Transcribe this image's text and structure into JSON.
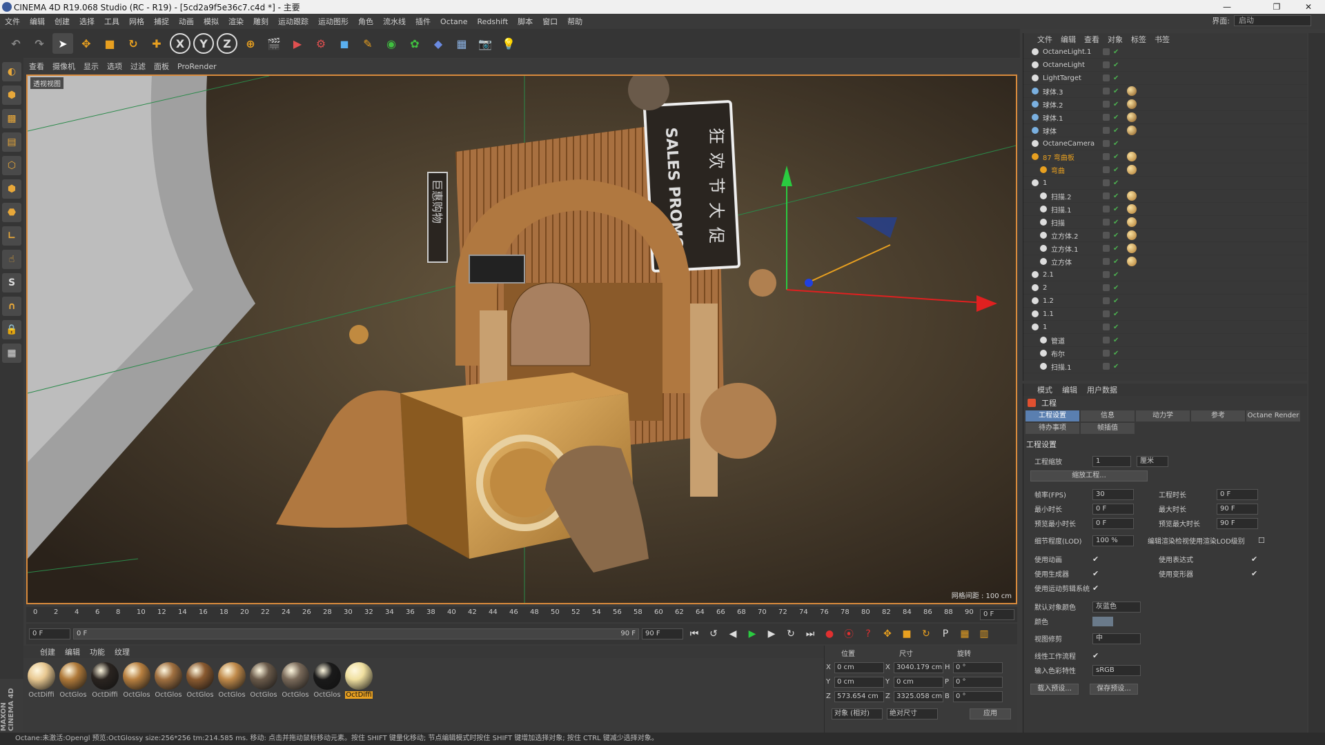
{
  "title": "CINEMA 4D R19.068 Studio (RC - R19) - [5cd2a9f5e36c7.c4d *] - 主要",
  "window_controls": {
    "min": "—",
    "max": "❐",
    "close": "✕"
  },
  "menu": [
    "文件",
    "编辑",
    "创建",
    "选择",
    "工具",
    "网格",
    "捕捉",
    "动画",
    "模拟",
    "渲染",
    "雕刻",
    "运动跟踪",
    "运动图形",
    "角色",
    "流水线",
    "插件",
    "Octane",
    "Redshift",
    "脚本",
    "窗口",
    "帮助"
  ],
  "layout": {
    "label": "界面:",
    "value": "启动"
  },
  "viewport_menu": [
    "查看",
    "摄像机",
    "显示",
    "选项",
    "过滤",
    "面板",
    "ProRender"
  ],
  "viewport": {
    "label": "透视视图",
    "grid_label": "网格间距 : 100 cm",
    "sign_text": "SALES PROMOTION",
    "sign_cn": "狂欢节大促",
    "sign_left": "巨惠购物"
  },
  "timeline": {
    "ticks": [
      "0",
      "2",
      "4",
      "6",
      "8",
      "10",
      "12",
      "14",
      "16",
      "18",
      "20",
      "22",
      "24",
      "26",
      "28",
      "30",
      "32",
      "34",
      "36",
      "38",
      "40",
      "42",
      "44",
      "46",
      "48",
      "50",
      "52",
      "54",
      "56",
      "58",
      "60",
      "62",
      "64",
      "66",
      "68",
      "70",
      "72",
      "74",
      "76",
      "78",
      "80",
      "82",
      "84",
      "86",
      "88",
      "90"
    ],
    "current": "0 F"
  },
  "playback": {
    "start": "0 F",
    "range_start": "0 F",
    "range_end": "90 F",
    "end": "90 F"
  },
  "material_menu": [
    "创建",
    "编辑",
    "功能",
    "纹理"
  ],
  "materials": [
    {
      "name": "OctDiffi",
      "color": "#e8c891"
    },
    {
      "name": "OctGlos",
      "color": "#b07a3a"
    },
    {
      "name": "OctDiffi",
      "color": "#2a2420"
    },
    {
      "name": "OctGlos",
      "color": "#b88040"
    },
    {
      "name": "OctGlos",
      "color": "#a07040"
    },
    {
      "name": "OctGlos",
      "color": "#8a5a30"
    },
    {
      "name": "OctGlos",
      "color": "#c08a4a"
    },
    {
      "name": "OctGlos",
      "color": "#6a5a4a"
    },
    {
      "name": "OctGlos",
      "color": "#7a6a5a"
    },
    {
      "name": "OctGlos",
      "color": "#1a1a1a"
    },
    {
      "name": "OctDiffi",
      "color": "#f0e0a0"
    }
  ],
  "coords": {
    "headers": [
      "位置",
      "尺寸",
      "旋转"
    ],
    "rows": [
      {
        "a": "X",
        "pos": "0 cm",
        "b": "X",
        "size": "3040.179 cm",
        "c": "H",
        "rot": "0 °"
      },
      {
        "a": "Y",
        "pos": "0 cm",
        "b": "Y",
        "size": "0 cm",
        "c": "P",
        "rot": "0 °"
      },
      {
        "a": "Z",
        "pos": "573.654 cm",
        "b": "Z",
        "size": "3325.058 cm",
        "c": "B",
        "rot": "0 °"
      }
    ],
    "mode1": "对象 (相对)",
    "mode2": "绝对尺寸",
    "apply": "应用"
  },
  "status": "Octane:未激活:Opengl 预览:OctGlossy size:256*256 tm:214.585 ms.   移动: 点击并拖动鼠标移动元素。按住 SHIFT 键量化移动; 节点编辑模式时按住 SHIFT 键增加选择对象; 按住 CTRL 键减少选择对象。",
  "logo": "MAXON CINEMA 4D",
  "objects_menu": [
    "文件",
    "编辑",
    "查看",
    "对象",
    "标签",
    "书签"
  ],
  "objects": [
    {
      "name": "OctaneLight.1",
      "indent": 0,
      "color": "#ddd",
      "hl": false
    },
    {
      "name": "OctaneLight",
      "indent": 0,
      "color": "#ddd",
      "hl": false
    },
    {
      "name": "LightTarget",
      "indent": 0,
      "color": "#ddd",
      "hl": false
    },
    {
      "name": "球体.3",
      "indent": 0,
      "color": "#7ab0e0",
      "hl": false
    },
    {
      "name": "球体.2",
      "indent": 0,
      "color": "#7ab0e0",
      "hl": false
    },
    {
      "name": "球体.1",
      "indent": 0,
      "color": "#7ab0e0",
      "hl": false
    },
    {
      "name": "球体",
      "indent": 0,
      "color": "#7ab0e0",
      "hl": false
    },
    {
      "name": "OctaneCamera",
      "indent": 0,
      "color": "#ddd",
      "hl": false
    },
    {
      "name": "87 弯曲板",
      "indent": 0,
      "color": "#e8a020",
      "hl": true
    },
    {
      "name": "弯曲",
      "indent": 1,
      "color": "#e8a020",
      "hl": true
    },
    {
      "name": "1",
      "indent": 0,
      "color": "#ddd",
      "hl": false
    },
    {
      "name": "扫描.2",
      "indent": 1,
      "color": "#ddd",
      "hl": false
    },
    {
      "name": "扫描.1",
      "indent": 1,
      "color": "#ddd",
      "hl": false
    },
    {
      "name": "扫描",
      "indent": 1,
      "color": "#ddd",
      "hl": false
    },
    {
      "name": "立方体.2",
      "indent": 1,
      "color": "#ddd",
      "hl": false
    },
    {
      "name": "立方体.1",
      "indent": 1,
      "color": "#ddd",
      "hl": false
    },
    {
      "name": "立方体",
      "indent": 1,
      "color": "#ddd",
      "hl": false
    },
    {
      "name": "2.1",
      "indent": 0,
      "color": "#ddd",
      "hl": false
    },
    {
      "name": "2",
      "indent": 0,
      "color": "#ddd",
      "hl": false
    },
    {
      "name": "1.2",
      "indent": 0,
      "color": "#ddd",
      "hl": false
    },
    {
      "name": "1.1",
      "indent": 0,
      "color": "#ddd",
      "hl": false
    },
    {
      "name": "1",
      "indent": 0,
      "color": "#ddd",
      "hl": false
    },
    {
      "name": "管道",
      "indent": 1,
      "color": "#ddd",
      "hl": false
    },
    {
      "name": "布尔",
      "indent": 1,
      "color": "#ddd",
      "hl": false
    },
    {
      "name": "扫描.1",
      "indent": 1,
      "color": "#ddd",
      "hl": false
    }
  ],
  "attr_menu": [
    "模式",
    "编辑",
    "用户数据"
  ],
  "attr_title": "工程",
  "attr_tabs": [
    "工程设置",
    "信息",
    "动力学",
    "参考",
    "Octane Render",
    "待办事项",
    "帧插值"
  ],
  "attr_section": "工程设置",
  "attr": {
    "scale_label": "工程缩放",
    "scale_value": "1",
    "scale_unit": "厘米",
    "scale_btn": "缩放工程...",
    "fps_label": "帧率(FPS)",
    "fps": "30",
    "len_label": "工程时长",
    "len": "0 F",
    "min_label": "最小时长",
    "min": "0 F",
    "max_label": "最大时长",
    "max": "90 F",
    "pmin_label": "预览最小时长",
    "pmin": "0 F",
    "pmax_label": "预览最大时长",
    "pmax": "90 F",
    "lod_label": "细节程度(LOD)",
    "lod": "100 %",
    "lod_check_label": "编辑渲染检视使用渲染LOD级别",
    "anim_label": "使用动画",
    "expr_label": "使用表达式",
    "gen_label": "使用生成器",
    "deform_label": "使用变形器",
    "motion_label": "使用运动剪辑系统",
    "defcolor_label": "默认对象颜色",
    "defcolor": "灰蓝色",
    "color_label": "颜色",
    "clip_label": "视图修剪",
    "clip": "中",
    "linear_label": "线性工作流程",
    "profile_label": "输入色彩特性",
    "profile": "sRGB",
    "load_btn": "载入预设...",
    "save_btn": "保存预设..."
  }
}
